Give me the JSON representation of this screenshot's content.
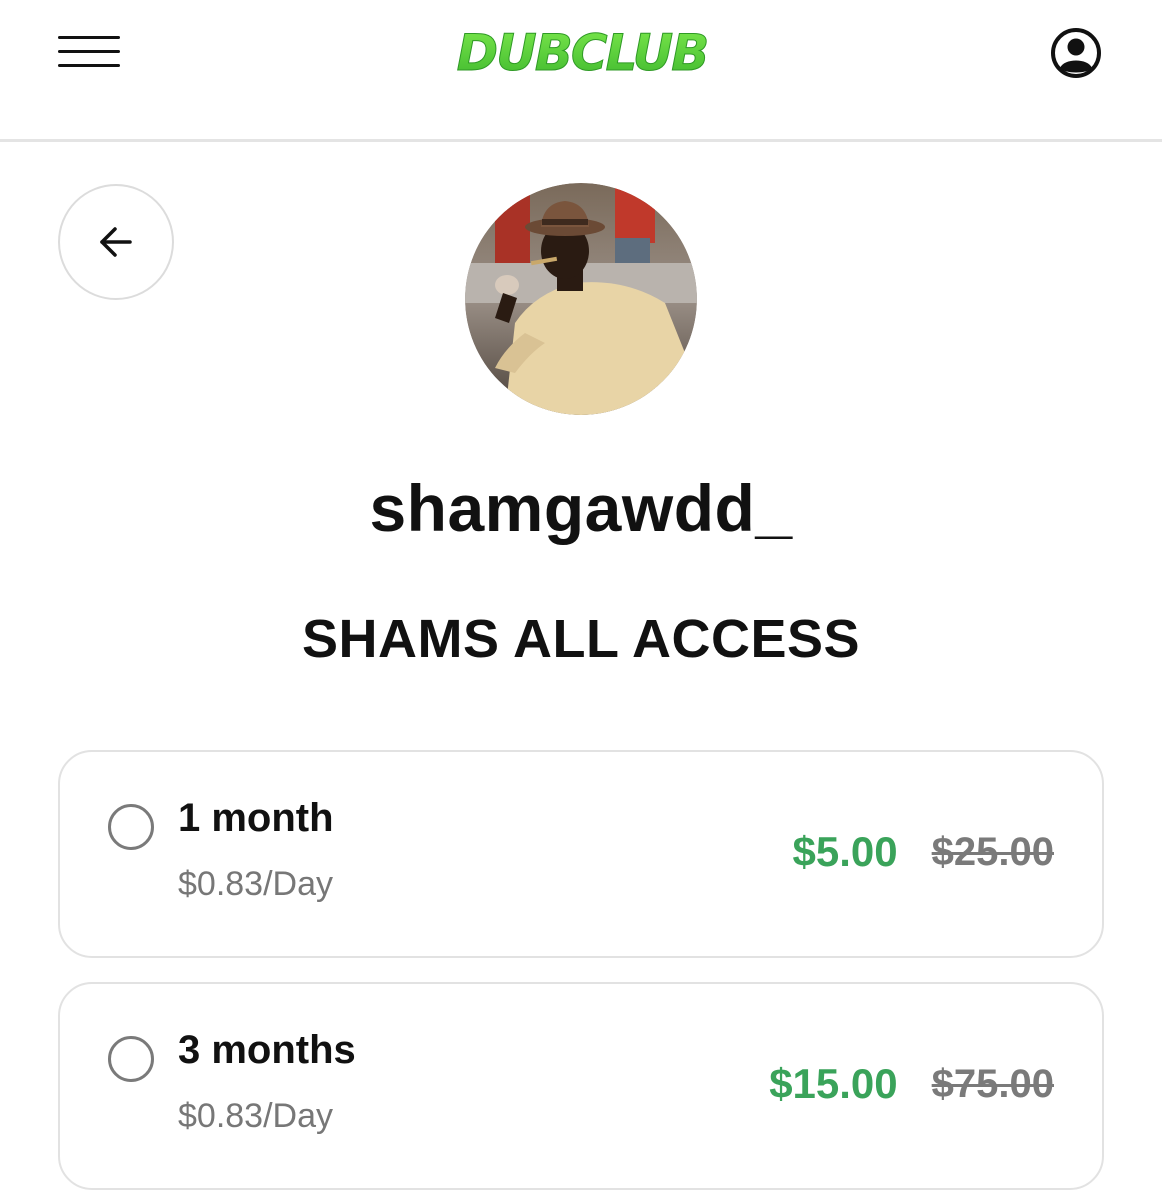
{
  "header": {
    "logo_text": "DUBCLUB",
    "menu_icon": "hamburger-menu-icon",
    "account_icon": "user-circle-icon",
    "brand_color": "#5fd33a"
  },
  "profile": {
    "back_icon": "arrow-left-icon",
    "username": "shamgawdd_",
    "plan_title": "SHAMS ALL ACCESS"
  },
  "options": [
    {
      "duration": "1 month",
      "per_day": "$0.83/Day",
      "price": "$5.00",
      "original_price": "$25.00",
      "selected": false
    },
    {
      "duration": "3 months",
      "per_day": "$0.83/Day",
      "price": "$15.00",
      "original_price": "$75.00",
      "selected": false
    }
  ],
  "colors": {
    "price_green": "#3aa35a",
    "muted_gray": "#777777",
    "border_gray": "#e2e2e2"
  }
}
